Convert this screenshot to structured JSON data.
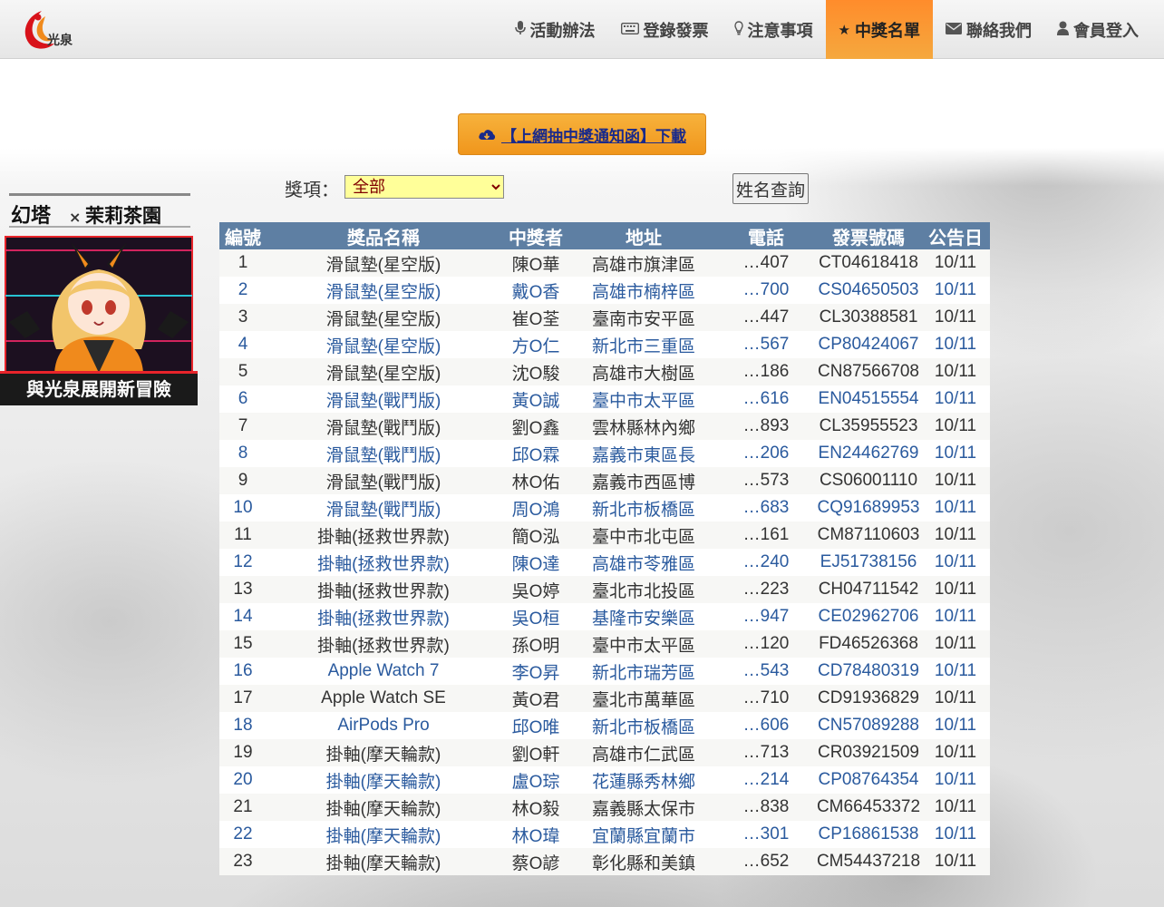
{
  "header": {
    "logo_text": "光泉",
    "nav": [
      {
        "label": "活動辦法",
        "icon": "microphone-icon",
        "active": false
      },
      {
        "label": "登錄發票",
        "icon": "keyboard-icon",
        "active": false
      },
      {
        "label": "注意事項",
        "icon": "lightbulb-icon",
        "active": false
      },
      {
        "label": "中獎名單",
        "icon": "star-icon",
        "active": true
      },
      {
        "label": "聯絡我們",
        "icon": "envelope-icon",
        "active": false
      },
      {
        "label": "會員登入",
        "icon": "user-icon",
        "active": false
      }
    ]
  },
  "download_button": {
    "label": "【上網抽中獎通知函】下載",
    "icon": "cloud-download-icon"
  },
  "filter": {
    "label": "獎項：",
    "selected": "全部"
  },
  "search_button": {
    "label": "姓名查詢"
  },
  "banner": {
    "line1": "幻塔",
    "line2": "茉莉茶園",
    "cross": "×",
    "tagline": "與光泉展開新冒險"
  },
  "colors": {
    "accent": "#f5a83e",
    "header_row": "#5e7fa3",
    "link": "#2a5a9e"
  },
  "table": {
    "headers": [
      "編號",
      "獎品名稱",
      "中獎者",
      "地址",
      "電話",
      "發票號碼",
      "公告日"
    ],
    "rows": [
      [
        "1",
        "滑鼠墊(星空版)",
        "陳O華",
        "高雄市旗津區",
        "…407",
        "CT04618418",
        "10/11"
      ],
      [
        "2",
        "滑鼠墊(星空版)",
        "戴O香",
        "高雄市楠梓區",
        "…700",
        "CS04650503",
        "10/11"
      ],
      [
        "3",
        "滑鼠墊(星空版)",
        "崔O荃",
        "臺南市安平區",
        "…447",
        "CL30388581",
        "10/11"
      ],
      [
        "4",
        "滑鼠墊(星空版)",
        "方O仁",
        "新北市三重區",
        "…567",
        "CP80424067",
        "10/11"
      ],
      [
        "5",
        "滑鼠墊(星空版)",
        "沈O駿",
        "高雄市大樹區",
        "…186",
        "CN87566708",
        "10/11"
      ],
      [
        "6",
        "滑鼠墊(戰鬥版)",
        "黃O誠",
        "臺中市太平區",
        "…616",
        "EN04515554",
        "10/11"
      ],
      [
        "7",
        "滑鼠墊(戰鬥版)",
        "劉O鑫",
        "雲林縣林內鄉",
        "…893",
        "CL35955523",
        "10/11"
      ],
      [
        "8",
        "滑鼠墊(戰鬥版)",
        "邱O霖",
        "嘉義市東區長",
        "…206",
        "EN24462769",
        "10/11"
      ],
      [
        "9",
        "滑鼠墊(戰鬥版)",
        "林O佑",
        "嘉義市西區博",
        "…573",
        "CS06001110",
        "10/11"
      ],
      [
        "10",
        "滑鼠墊(戰鬥版)",
        "周O鴻",
        "新北市板橋區",
        "…683",
        "CQ91689953",
        "10/11"
      ],
      [
        "11",
        "掛軸(拯救世界款)",
        "簡O泓",
        "臺中市北屯區",
        "…161",
        "CM87110603",
        "10/11"
      ],
      [
        "12",
        "掛軸(拯救世界款)",
        "陳O達",
        "高雄市苓雅區",
        "…240",
        "EJ51738156",
        "10/11"
      ],
      [
        "13",
        "掛軸(拯救世界款)",
        "吳O婷",
        "臺北市北投區",
        "…223",
        "CH04711542",
        "10/11"
      ],
      [
        "14",
        "掛軸(拯救世界款)",
        "吳O桓",
        "基隆市安樂區",
        "…947",
        "CE02962706",
        "10/11"
      ],
      [
        "15",
        "掛軸(拯救世界款)",
        "孫O明",
        "臺中市太平區",
        "…120",
        "FD46526368",
        "10/11"
      ],
      [
        "16",
        "Apple Watch 7",
        "李O昇",
        "新北市瑞芳區",
        "…543",
        "CD78480319",
        "10/11"
      ],
      [
        "17",
        "Apple Watch SE",
        "黃O君",
        "臺北市萬華區",
        "…710",
        "CD91936829",
        "10/11"
      ],
      [
        "18",
        "AirPods Pro",
        "邱O唯",
        "新北市板橋區",
        "…606",
        "CN57089288",
        "10/11"
      ],
      [
        "19",
        "掛軸(摩天輪款)",
        "劉O軒",
        "高雄市仁武區",
        "…713",
        "CR03921509",
        "10/11"
      ],
      [
        "20",
        "掛軸(摩天輪款)",
        "盧O琮",
        "花蓮縣秀林鄉",
        "…214",
        "CP08764354",
        "10/11"
      ],
      [
        "21",
        "掛軸(摩天輪款)",
        "林O毅",
        "嘉義縣太保市",
        "…838",
        "CM66453372",
        "10/11"
      ],
      [
        "22",
        "掛軸(摩天輪款)",
        "林O瑋",
        "宜蘭縣宜蘭市",
        "…301",
        "CP16861538",
        "10/11"
      ],
      [
        "23",
        "掛軸(摩天輪款)",
        "蔡O諺",
        "彰化縣和美鎮",
        "…652",
        "CM54437218",
        "10/11"
      ]
    ]
  }
}
